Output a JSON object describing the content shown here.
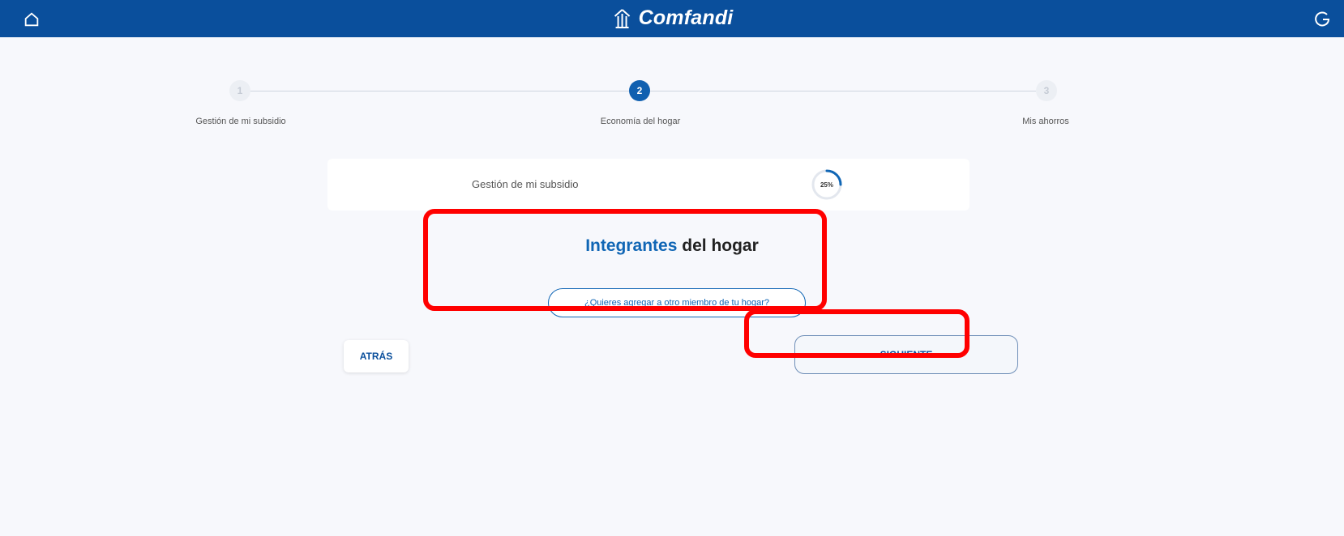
{
  "header": {
    "brand_name": "Comfandi",
    "home_icon": "home-icon",
    "logout_icon": "logout-icon",
    "bar_color": "#0a4f9c"
  },
  "stepper": {
    "steps": [
      {
        "number": "1",
        "label": "Gestión de mi subsidio",
        "state": "inactive"
      },
      {
        "number": "2",
        "label": "Economía del hogar",
        "state": "active"
      },
      {
        "number": "3",
        "label": "Mis ahorros",
        "state": "inactive"
      }
    ]
  },
  "progress": {
    "title": "Gestión de mi subsidio",
    "percent_label": "25%",
    "percent_value": 25
  },
  "section": {
    "title_accent": "Integrantes",
    "title_rest": "del hogar",
    "add_member_label": "¿Quieres agregar a otro miembro de tu hogar?"
  },
  "actions": {
    "back_label": "ATRÁS",
    "next_label": "SIGUIENTE"
  },
  "colors": {
    "accent": "#1066b5",
    "highlight": "#ff0000"
  }
}
